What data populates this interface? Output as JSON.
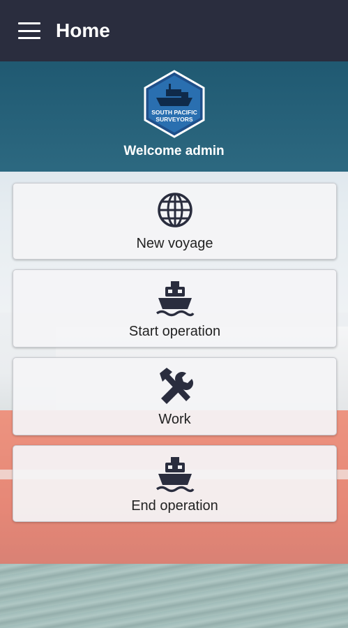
{
  "app_bar": {
    "title": "Home",
    "menu_icon": "hamburger-menu-icon"
  },
  "header": {
    "logo": {
      "line1": "SOUTH PACIFIC",
      "line2": "SURVEYORS",
      "icon": "ship-badge-logo"
    },
    "welcome_text": "Welcome admin"
  },
  "actions": [
    {
      "label": "New voyage",
      "icon": "globe-icon"
    },
    {
      "label": "Start operation",
      "icon": "ship-icon"
    },
    {
      "label": "Work",
      "icon": "tools-icon"
    },
    {
      "label": "End operation",
      "icon": "ship-icon"
    }
  ],
  "colors": {
    "app_bar": "#2a2d3e",
    "header": "#1d5a73",
    "icon": "#2a2d3e"
  }
}
